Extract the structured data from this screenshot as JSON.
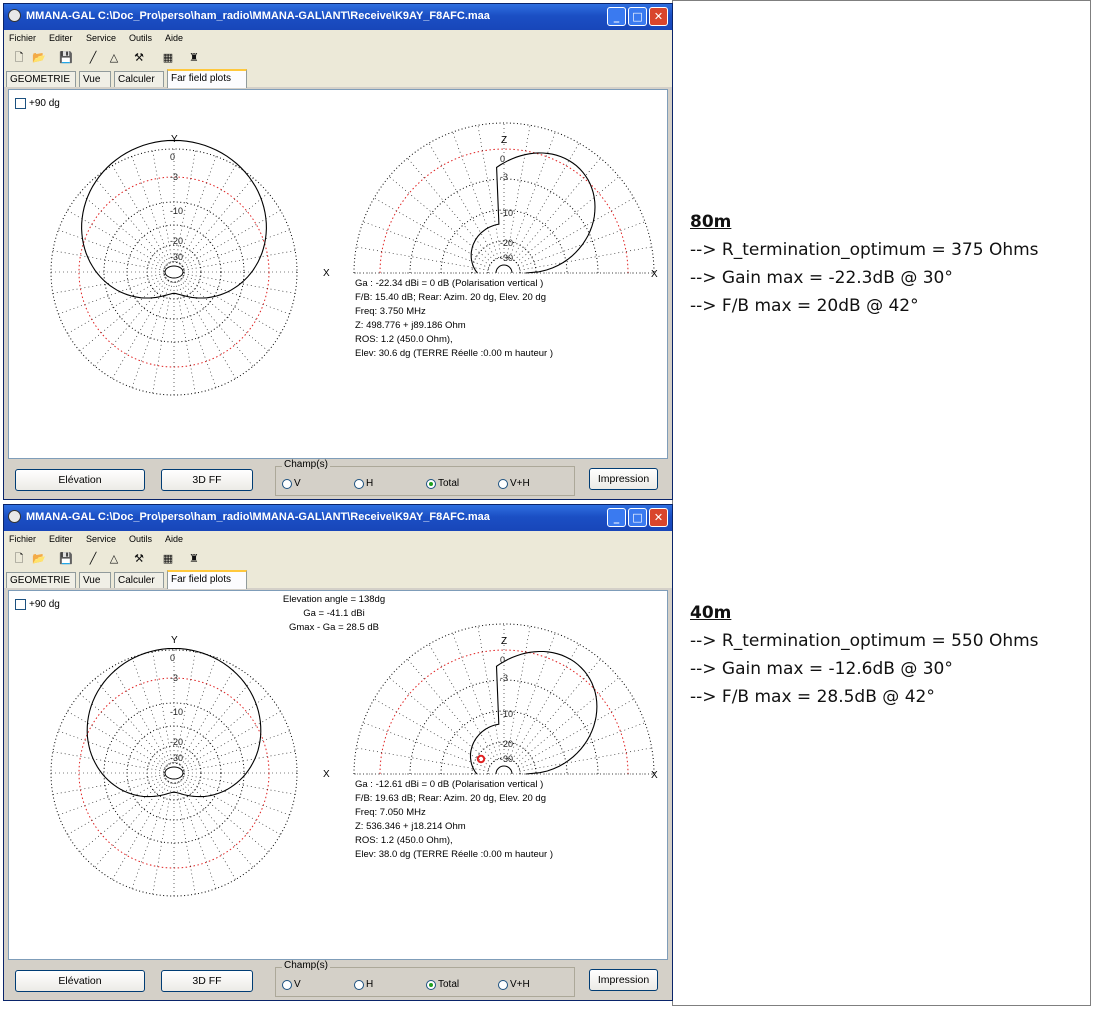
{
  "window1": {
    "title": "MMANA-GAL C:\\Doc_Pro\\perso\\ham_radio\\MMANA-GAL\\ANT\\Receive\\K9AY_F8AFC.maa",
    "menu": [
      "Fichier",
      "Editer",
      "Service",
      "Outils",
      "Aide"
    ],
    "tabs": [
      "GEOMETRIE",
      "Vue",
      "Calculer",
      "Far field plots"
    ],
    "active_tab": "Far field plots",
    "checkbox_label": "+90 dg",
    "axis_labels": {
      "y": "Y",
      "z": "Z",
      "x": "X"
    },
    "ring_labels": [
      "0",
      "-3",
      "-10",
      "-20",
      "-30"
    ],
    "info_lines": [
      "Ga : -22.34 dBi = 0 dB  (Polarisation vertical )",
      "F/B: 15.40 dB; Rear: Azim. 20 dg, Elev. 20 dg",
      "Freq: 3.750 MHz",
      "Z: 498.776 + j89.186 Ohm",
      "ROS: 1.2 (450.0 Ohm),",
      "Elev: 30.6 dg (TERRE Réelle   :0.00 m hauteur )"
    ],
    "buttons": {
      "elevation": "Elévation",
      "ff3d": "3D FF",
      "print": "Impression"
    },
    "champs_title": "Champ(s)",
    "radios": [
      "V",
      "H",
      "Total",
      "V+H"
    ],
    "selected_radio": "Total"
  },
  "window2": {
    "title": "MMANA-GAL C:\\Doc_Pro\\perso\\ham_radio\\MMANA-GAL\\ANT\\Receive\\K9AY_F8AFC.maa",
    "menu": [
      "Fichier",
      "Editer",
      "Service",
      "Outils",
      "Aide"
    ],
    "tabs": [
      "GEOMETRIE",
      "Vue",
      "Calculer",
      "Far field plots"
    ],
    "active_tab": "Far field plots",
    "checkbox_label": "+90 dg",
    "elevation_box": [
      "Elevation angle = 138dg",
      "Ga = -41.1 dBi",
      "Gmax - Ga = 28.5 dB"
    ],
    "axis_labels": {
      "y": "Y",
      "z": "Z",
      "x": "X"
    },
    "ring_labels": [
      "0",
      "-3",
      "-10",
      "-20",
      "-30"
    ],
    "info_lines": [
      "Ga : -12.61 dBi = 0 dB  (Polarisation vertical )",
      "F/B: 19.63 dB; Rear: Azim. 20 dg, Elev. 20 dg",
      "Freq: 7.050 MHz",
      "Z: 536.346 + j18.214 Ohm",
      "ROS: 1.2 (450.0 Ohm),",
      "Elev: 38.0 dg (TERRE Réelle   :0.00 m hauteur )"
    ],
    "buttons": {
      "elevation": "Elévation",
      "ff3d": "3D FF",
      "print": "Impression"
    },
    "champs_title": "Champ(s)",
    "radios": [
      "V",
      "H",
      "Total",
      "V+H"
    ],
    "selected_radio": "Total"
  },
  "notes": {
    "band80": {
      "heading": "80m",
      "lines": [
        "--> R_termination_optimum = 375 Ohms",
        "--> Gain max = -22.3dB @ 30°",
        "--> F/B max = 20dB @ 42°"
      ]
    },
    "band40": {
      "heading": "40m",
      "lines": [
        "--> R_termination_optimum = 550 Ohms",
        "--> Gain max = -12.6dB @ 30°",
        "--> F/B max = 28.5dB @ 42°"
      ]
    }
  },
  "colors": {
    "titlebar": "#1b4fc4",
    "ref_ring": "#e02020",
    "pattern": "#000000"
  }
}
